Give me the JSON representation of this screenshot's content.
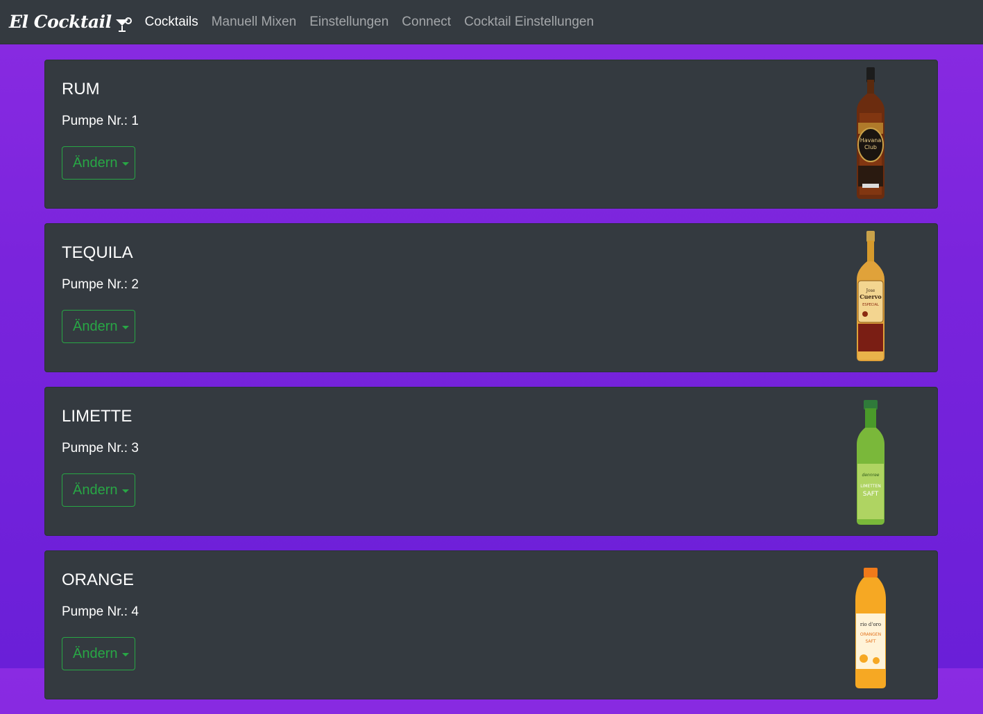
{
  "nav": {
    "brand": "El Cocktail",
    "links": [
      "Cocktails",
      "Manuell Mixen",
      "Einstellungen",
      "Connect",
      "Cocktail Einstellungen"
    ]
  },
  "pumps": [
    {
      "name": "RUM",
      "pump_label": "Pumpe Nr.: 1",
      "button": "Ändern",
      "bottle": {
        "label1": "Havana",
        "label2": "Club"
      },
      "bottle_icon": "rum-bottle"
    },
    {
      "name": "TEQUILA",
      "pump_label": "Pumpe Nr.: 2",
      "button": "Ändern",
      "bottle": {
        "label1": "Jose",
        "label2": "Cuervo",
        "label3": "ESPECIAL"
      },
      "bottle_icon": "tequila-bottle"
    },
    {
      "name": "LIMETTE",
      "pump_label": "Pumpe Nr.: 3",
      "button": "Ändern",
      "bottle": {
        "label1": "dennree",
        "label2": "LIMETTEN",
        "label3": "SAFT"
      },
      "bottle_icon": "lime-juice-bottle"
    },
    {
      "name": "ORANGE",
      "pump_label": "Pumpe Nr.: 4",
      "button": "Ändern",
      "bottle": {
        "label1": "rio d'oro",
        "label2": "ORANGEN",
        "label3": "SAFT"
      },
      "bottle_icon": "orange-juice-bottle"
    }
  ],
  "colors": {
    "navbar": "#343a40",
    "background_top": "#8a2be2",
    "background_bottom": "#6a1fd8",
    "card": "#343a40",
    "button": "#28a745"
  }
}
